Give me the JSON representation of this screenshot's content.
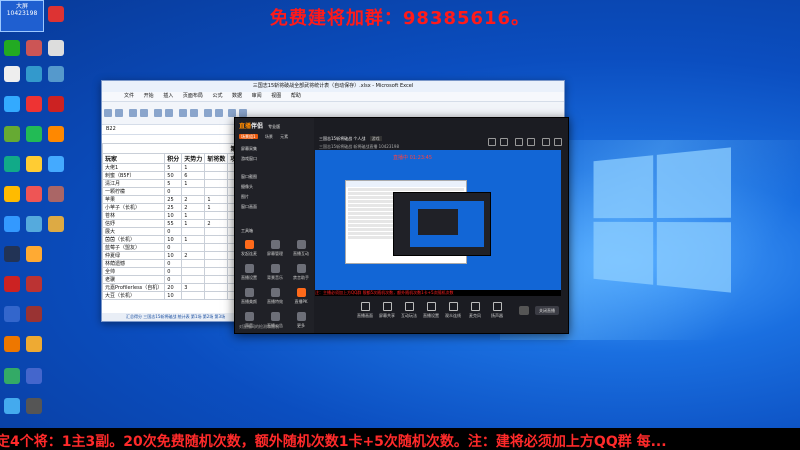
{
  "banner": {
    "text": "免费建将加群：98385616。"
  },
  "desktop": {
    "logo": {
      "line1": "大屏",
      "line2": "10423198"
    },
    "icons": [
      "computer-icon",
      "wechat-icon",
      "phone-icon",
      "nvidia-icon",
      "browser-icon",
      "folder-icon",
      "recycle-bin-icon",
      "steam-icon",
      "game-icon",
      "kugou-icon",
      "qq-icon",
      "game2-icon",
      "obs-icon",
      "settings-icon",
      "excel-icon",
      "video-icon"
    ]
  },
  "excel": {
    "title": "三国志15斩将破战全部武将统计表（自动保存）.xlsx - Microsoft Excel",
    "menu": [
      "文件",
      "开始",
      "插入",
      "页面布局",
      "公式",
      "数据",
      "审阅",
      "视图",
      "帮助"
    ],
    "formula_name": "B22",
    "sheet_title": "第一场",
    "columns": [
      "玩家",
      "积分",
      "天势力",
      "斩将数",
      "攻城数"
    ],
    "rows": [
      [
        "大佬1",
        "5",
        "1",
        "",
        ""
      ],
      [
        "刺蜜（B5F）",
        "50",
        "6",
        "",
        ""
      ],
      [
        "清江月",
        "5",
        "1",
        "",
        ""
      ],
      [
        "一颗柠檬",
        "0",
        "",
        "",
        ""
      ],
      [
        "苹果",
        "25",
        "2",
        "1",
        ""
      ],
      [
        "小苹子（长机）",
        "25",
        "2",
        "1",
        ""
      ],
      [
        "苍林",
        "10",
        "1",
        "",
        ""
      ],
      [
        "信妤",
        "55",
        "1",
        "2",
        ""
      ],
      [
        "展大",
        "0",
        "",
        "",
        ""
      ],
      [
        "茵茵（长机）",
        "10",
        "1",
        "",
        ""
      ],
      [
        "蓝莓子（盟友）",
        "0",
        "",
        "",
        ""
      ],
      [
        "仲夏绿",
        "10",
        "2",
        "",
        ""
      ],
      [
        "林荫遗憾",
        "0",
        "",
        "",
        ""
      ],
      [
        "全帅",
        "0",
        "",
        "",
        ""
      ],
      [
        "老骥",
        "0",
        "",
        "",
        ""
      ],
      [
        "元嘉Profilerless（自机）",
        "20",
        "3",
        "",
        ""
      ],
      [
        "大豆（长机）",
        "10",
        "",
        "",
        ""
      ]
    ],
    "tabs": "汇总得分  三国志15斩将破战 统计表 第1场 第2场 第3场"
  },
  "live": {
    "brand_main": "直播",
    "brand_sub": "伴侣",
    "tag": "专业版",
    "tabs": [
      "场景组1",
      "场景",
      "元素"
    ],
    "scenes": [
      "屏幕采集",
      "游戏窗口",
      "窗口截图",
      "摄像头",
      "图片",
      "窗口画面"
    ],
    "tools_title": "工具箱",
    "tools": [
      "发起连麦",
      "屏幕管理",
      "直播互动",
      "直播设置",
      "背景音乐",
      "禁言助手",
      "直播美颜",
      "直播特效",
      "直播PK",
      "声音",
      "直播公告",
      "更多"
    ],
    "notice": "对直播间的检测和限制",
    "room_title": "三国志15斩将破战 个人战",
    "room_tag": "游戏",
    "room_meta": [
      "三国志15斩将破战",
      "斩将破战直播",
      "10423198"
    ],
    "live_label": "直播中 01:23:45",
    "ticker": "注：主播必须加上方QQ群   限额5次随机次数，额外随机次数1卡+5次随机次数",
    "controls": [
      "直播画面",
      "屏幕共享",
      "互动玩法",
      "直播设置",
      "观众连线",
      "麦克风",
      "扬声器"
    ],
    "start_label": "关闭直播"
  },
  "ticker": {
    "text": "定4个将：1主3副。20次免费随机次数，额外随机次数1卡+5次随机次数。注：建将必须加上方QQ群        每..."
  }
}
